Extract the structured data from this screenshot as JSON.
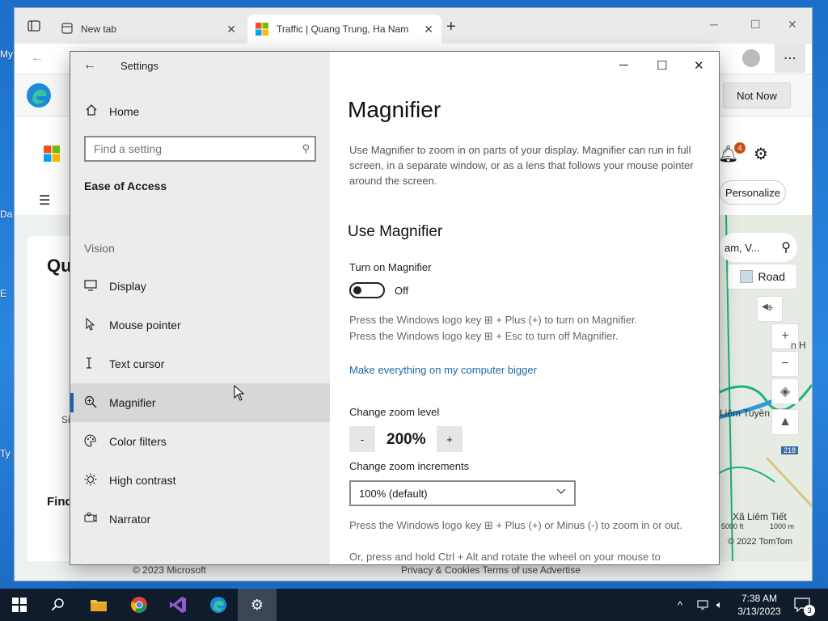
{
  "desktop": {
    "icon_labels": [
      "My",
      "Da",
      "E",
      "Ty"
    ]
  },
  "browser": {
    "tabs": [
      {
        "label": "New tab"
      },
      {
        "label": "Traffic | Quang Trung, Ha Nam"
      }
    ],
    "new_tab_symbol": "+",
    "infobar": {
      "not_now": "Not Now"
    },
    "personalize": "Personalize",
    "page_heading_fragment": "Qu",
    "find_fragment": "Find",
    "side_fragment": "Si",
    "map": {
      "search_text": "am, V...",
      "road_label": "Road",
      "places": [
        "Liêm Tuyền",
        "Xã Liêm Tiết",
        "n H"
      ],
      "road_shield": "218",
      "scale_ft": "5000 ft",
      "scale_m": "1000 m",
      "copyright": "© 2022 TomTom"
    },
    "footer": {
      "left": "© 2023 Microsoft",
      "right": "Privacy & Cookies   Terms of use   Advertise"
    },
    "notification_count": "4"
  },
  "settings": {
    "app_title": "Settings",
    "home": "Home",
    "search_placeholder": "Find a setting",
    "section": "Ease of Access",
    "group": "Vision",
    "nav": [
      {
        "label": "Display",
        "icon": "display-icon"
      },
      {
        "label": "Mouse pointer",
        "icon": "mouse-pointer-icon"
      },
      {
        "label": "Text cursor",
        "icon": "text-cursor-icon"
      },
      {
        "label": "Magnifier",
        "icon": "magnifier-icon",
        "selected": true
      },
      {
        "label": "Color filters",
        "icon": "color-filters-icon"
      },
      {
        "label": "High contrast",
        "icon": "high-contrast-icon"
      },
      {
        "label": "Narrator",
        "icon": "narrator-icon"
      }
    ],
    "page": {
      "title": "Magnifier",
      "description": "Use Magnifier to zoom in on parts of your display. Magnifier can run in full screen, in a separate window, or as a lens that follows your mouse pointer around the screen.",
      "use_heading": "Use Magnifier",
      "turn_on_label": "Turn on Magnifier",
      "toggle_state": "Off",
      "hint_on": "Press the Windows logo key ⊞ + Plus (+) to turn on Magnifier.",
      "hint_off": "Press the Windows logo key ⊞ + Esc to turn off Magnifier.",
      "bigger_link": "Make everything on my computer bigger",
      "zoom_label": "Change zoom level",
      "zoom_minus": "-",
      "zoom_value": "200%",
      "zoom_plus": "+",
      "increments_label": "Change zoom increments",
      "increments_value": "100% (default)",
      "hint_zoom": "Press the Windows logo key ⊞ + Plus (+) or Minus (-) to zoom in or out.",
      "hint_wheel": "Or, press and hold Ctrl + Alt and rotate the wheel on your mouse to"
    }
  },
  "taskbar": {
    "clock_time": "7:38 AM",
    "clock_date": "3/13/2023",
    "notification_count": "3"
  }
}
